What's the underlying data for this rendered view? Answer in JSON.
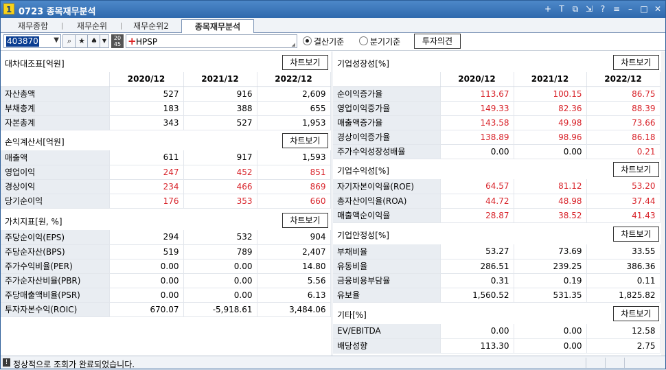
{
  "window": {
    "number": "1",
    "title": "0723 종목재무분석"
  },
  "tabs": [
    {
      "label": "재무종합"
    },
    {
      "label": "재무순위"
    },
    {
      "label": "재무순위2"
    },
    {
      "label": "종목재무분석"
    }
  ],
  "toolbar": {
    "code": "403870",
    "stock_name": "HPSP",
    "badge": "20\n45",
    "radio_settlement": "결산기준",
    "radio_quarter": "분기기준",
    "opinion_button": "투자의견"
  },
  "chart_button_label": "차트보기",
  "left": {
    "headers": [
      "2020/12",
      "2021/12",
      "2022/12"
    ],
    "balance": {
      "title": "대차대조표[억원]",
      "rows": [
        {
          "label": "자산총액",
          "v": [
            "527",
            "916",
            "2,609"
          ],
          "red": false
        },
        {
          "label": "부채총계",
          "v": [
            "183",
            "388",
            "655"
          ],
          "red": false
        },
        {
          "label": "자본총계",
          "v": [
            "343",
            "527",
            "1,953"
          ],
          "red": false
        }
      ]
    },
    "income": {
      "title": "손익계산서[억원]",
      "rows": [
        {
          "label": "매출액",
          "v": [
            "611",
            "917",
            "1,593"
          ],
          "red": false
        },
        {
          "label": "영업이익",
          "v": [
            "247",
            "452",
            "851"
          ],
          "red": true
        },
        {
          "label": "경상이익",
          "v": [
            "234",
            "466",
            "869"
          ],
          "red": true
        },
        {
          "label": "당기순이익",
          "v": [
            "176",
            "353",
            "660"
          ],
          "red": true
        }
      ]
    },
    "value": {
      "title": "가치지표[원, %]",
      "rows": [
        {
          "label": "주당순이익(EPS)",
          "v": [
            "294",
            "532",
            "904"
          ],
          "red": false
        },
        {
          "label": "주당순자산(BPS)",
          "v": [
            "519",
            "789",
            "2,407"
          ],
          "red": false
        },
        {
          "label": "주가수익비율(PER)",
          "v": [
            "0.00",
            "0.00",
            "14.80"
          ],
          "red": false
        },
        {
          "label": "주가순자산비율(PBR)",
          "v": [
            "0.00",
            "0.00",
            "5.56"
          ],
          "red": false
        },
        {
          "label": "주당매출액비율(PSR)",
          "v": [
            "0.00",
            "0.00",
            "6.13"
          ],
          "red": false
        },
        {
          "label": "투자자본수익(ROIC)",
          "v": [
            "670.07",
            "-5,918.61",
            "3,484.06"
          ],
          "red": false
        }
      ]
    }
  },
  "right": {
    "headers": [
      "2020/12",
      "2021/12",
      "2022/12"
    ],
    "growth": {
      "title": "기업성장성[%]",
      "rows": [
        {
          "label": "순이익증가율",
          "v": [
            "113.67",
            "100.15",
            "86.75"
          ],
          "red": true
        },
        {
          "label": "영업이익증가율",
          "v": [
            "149.33",
            "82.36",
            "88.39"
          ],
          "red": true
        },
        {
          "label": "매출액증가율",
          "v": [
            "143.58",
            "49.98",
            "73.66"
          ],
          "red": true
        },
        {
          "label": "경상이익증가율",
          "v": [
            "138.89",
            "98.96",
            "86.18"
          ],
          "red": true
        },
        {
          "label": "주가수익성장성배율",
          "v": [
            "0.00",
            "0.00",
            "0.21"
          ],
          "red": "last"
        }
      ]
    },
    "profit": {
      "title": "기업수익성[%]",
      "rows": [
        {
          "label": "자기자본이익율(ROE)",
          "v": [
            "64.57",
            "81.12",
            "53.20"
          ],
          "red": true
        },
        {
          "label": "총자산이익율(ROA)",
          "v": [
            "44.72",
            "48.98",
            "37.44"
          ],
          "red": true
        },
        {
          "label": "매출액순이익율",
          "v": [
            "28.87",
            "38.52",
            "41.43"
          ],
          "red": true
        }
      ]
    },
    "stability": {
      "title": "기업안정성[%]",
      "rows": [
        {
          "label": "부채비율",
          "v": [
            "53.27",
            "73.69",
            "33.55"
          ],
          "red": false
        },
        {
          "label": "유동비율",
          "v": [
            "286.51",
            "239.25",
            "386.36"
          ],
          "red": false
        },
        {
          "label": "금융비용부담율",
          "v": [
            "0.31",
            "0.19",
            "0.11"
          ],
          "red": false
        },
        {
          "label": "유보율",
          "v": [
            "1,560.52",
            "531.35",
            "1,825.82"
          ],
          "red": false
        }
      ]
    },
    "etc": {
      "title": "기타[%]",
      "rows": [
        {
          "label": "EV/EBITDA",
          "v": [
            "0.00",
            "0.00",
            "12.58"
          ],
          "red": false
        },
        {
          "label": "배당성향",
          "v": [
            "113.30",
            "0.00",
            "2.75"
          ],
          "red": false
        }
      ]
    }
  },
  "status": {
    "message": "정상적으로 조회가 완료되었습니다."
  }
}
